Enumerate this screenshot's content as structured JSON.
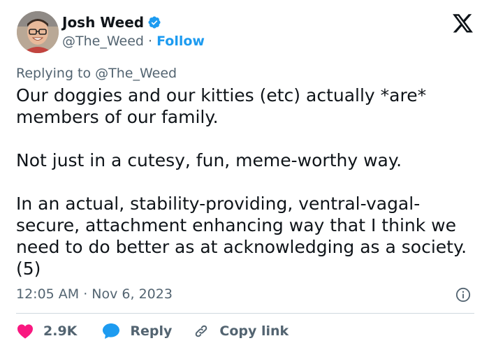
{
  "author": {
    "display_name": "Josh Weed",
    "handle": "@The_Weed",
    "separator": "·",
    "follow_label": "Follow",
    "verified_icon": "verified-badge-icon"
  },
  "brand": {
    "logo_icon": "x-logo-icon",
    "accent_color": "#1d9bf0",
    "like_color": "#f91880"
  },
  "tweet": {
    "replying_to": "Replying to @The_Weed",
    "paragraphs": [
      "Our doggies and our kitties (etc) actually *are* members of our family.",
      "Not just in a cutesy, fun, meme-worthy way.",
      "In an actual, stability-providing, ventral-vagal-secure, attachment enhancing way that I think we need to do better as at acknowledging as a society. (5)"
    ],
    "timestamp": "12:05 AM · Nov 6, 2023"
  },
  "actions": {
    "like_count": "2.9K",
    "reply_label": "Reply",
    "copy_link_label": "Copy link"
  }
}
